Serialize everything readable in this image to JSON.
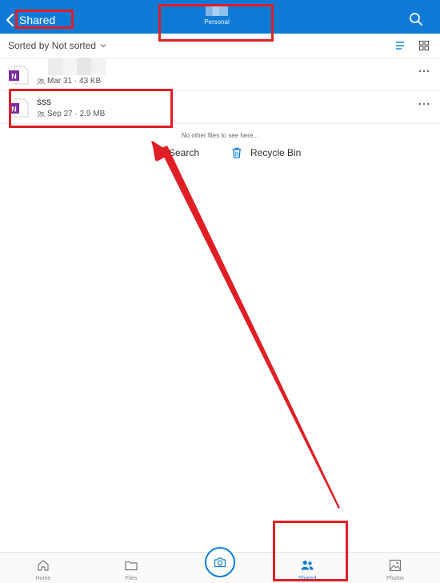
{
  "header": {
    "back_label": "Shared",
    "title_subtitle": "Personal"
  },
  "sort": {
    "label": "Sorted by Not sorted"
  },
  "files": [
    {
      "name": "",
      "meta": "Mar 31 · 43 KB",
      "icon": "onenote-icon"
    },
    {
      "name": "sss",
      "meta": "Sep 27 · 2.9 MB",
      "icon": "onenote-icon"
    }
  ],
  "empty_note": "No other files to see here...",
  "actions": {
    "search_label": "Search",
    "recycle_label": "Recycle Bin"
  },
  "tabs": {
    "home": "Home",
    "files": "Files",
    "shared": "Shared",
    "photos": "Photos"
  },
  "colors": {
    "accent": "#0f7ad5",
    "annotation": "#e01e25",
    "onenote": "#7b2aa0"
  }
}
